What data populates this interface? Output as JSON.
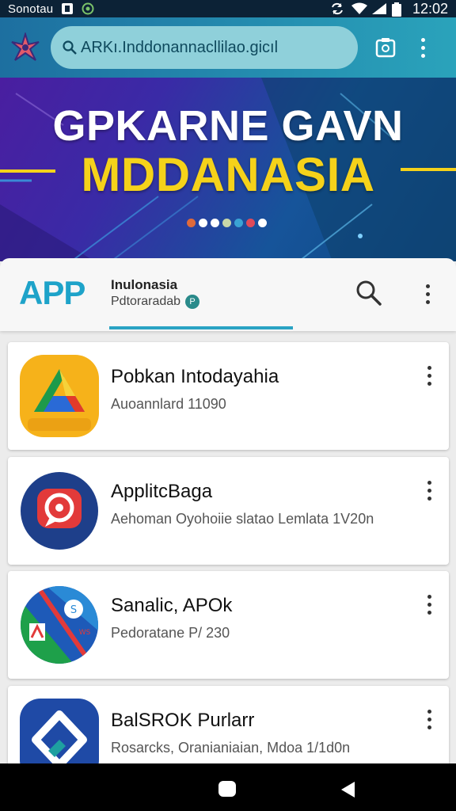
{
  "status_bar": {
    "carrier": "Sonotau",
    "time": "12:02",
    "icons": [
      "app-notification-icon",
      "location-icon",
      "sync-icon",
      "wifi-icon",
      "signal-icon",
      "battery-icon"
    ]
  },
  "browser": {
    "url": "ARKı.Inddonannacllilao.gicıl",
    "icons": [
      "browser-logo-icon",
      "search-icon",
      "tab-icon",
      "more-vert-icon"
    ]
  },
  "banner": {
    "line1": "GPKARNE GAVN",
    "line2": "MDDANASIA",
    "dots": [
      "#e06a3a",
      "#ffffff",
      "#ffffff",
      "#c8d6a8",
      "#3aa3d4",
      "#e04a5a",
      "#ffffff"
    ],
    "colors": {
      "title": "#ffffff",
      "highlight": "#f5d21a"
    }
  },
  "app_header": {
    "logo_text": "APP",
    "title": "Inulonasia",
    "subtitle": "Pdtoraradab",
    "accent": "#1ea3c9",
    "icons": [
      "search-icon",
      "more-vert-icon"
    ]
  },
  "apps": [
    {
      "title": "Pobkan Intodayahia",
      "subtitle": "Auoannlard 11090",
      "icon": "google-drive-icon"
    },
    {
      "title": "ApplitcBaga",
      "subtitle": "Aehoman Oyohoiie slatao Lemlata 1V20n",
      "icon": "chat-bubble-icon"
    },
    {
      "title": "Sanalic, APOk",
      "subtitle": "Pedoratane P/ 230",
      "icon": "split-shortcut-icon"
    },
    {
      "title": "BalSROK Purlarr",
      "subtitle": "Rosarcks, Oranianiaian, Mdoa 1/1d0n",
      "icon": "diamond-app-icon"
    }
  ],
  "nav_bar": {
    "icons": [
      "home-icon",
      "back-icon"
    ]
  }
}
